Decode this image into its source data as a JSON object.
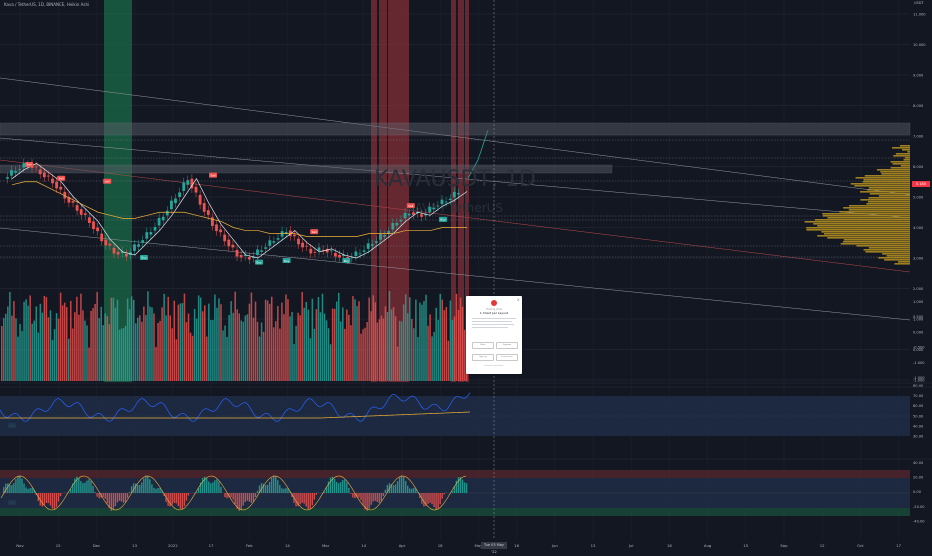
{
  "header": {
    "title": "Kava / TetherUS, 1D, BINANCE, Heikin Ashi"
  },
  "watermark": {
    "symbol": "KAVAUSDT, 1D",
    "name": "KAVA / TetherUS"
  },
  "axis_currency": "USDT",
  "current_price_badge": "5.180",
  "crosshair_date": "Tue 03 May '22",
  "popup": {
    "close": "×",
    "subtitle": "Trading View",
    "title": "1 Chart per Layout",
    "btn1": "Basic",
    "btn2": "Upgrade",
    "btn3": "Sign up",
    "btn4": "Learn more",
    "footer": "Continue with basic"
  },
  "colors": {
    "background": "#131722",
    "bull": "#26a69a",
    "bear": "#ef5350",
    "ma": "#f0b23a",
    "green_zone": "#1b6b48",
    "red_zone": "#7a2d34",
    "rsi": "#2962ff",
    "rsi_band": "#1e2b44"
  },
  "chart_data": {
    "type": "candlestick",
    "x_ticks": [
      "Nov",
      "15",
      "Dec",
      "13",
      "2022",
      "17",
      "Feb",
      "14",
      "Mar",
      "14",
      "Apr",
      "18",
      "May",
      "16",
      "Jun",
      "13",
      "Jul",
      "18",
      "Aug",
      "15",
      "Sep",
      "12",
      "Oct",
      "17"
    ],
    "price_ticks": [
      "11.000",
      "10.000",
      "9.000",
      "8.000",
      "7.000",
      "6.000",
      "5.000",
      "4.000",
      "3.000",
      "2.000",
      "1.000",
      "0.000",
      "-1.000"
    ],
    "volume_ticks": [
      "1.000",
      "0.500",
      "0.000",
      "-0.500",
      "-1.000",
      "-1.500"
    ],
    "rsi_ticks": [
      "80.00",
      "70.00",
      "60.00",
      "50.00",
      "40.00",
      "30.00"
    ],
    "osc_ticks": [
      "40.00",
      "20.00",
      "0.00",
      "-20.00",
      "-40.00"
    ],
    "price_path": [
      5.6,
      5.9,
      6.1,
      5.8,
      5.5,
      5.0,
      4.6,
      4.2,
      3.6,
      3.2,
      3.1,
      3.5,
      3.9,
      4.4,
      5.0,
      5.6,
      4.8,
      4.1,
      3.6,
      3.1,
      3.0,
      3.3,
      3.6,
      3.9,
      3.5,
      3.2,
      3.3,
      3.1,
      3.0,
      3.2,
      3.5,
      3.8,
      4.2,
      4.5,
      4.4,
      4.7,
      4.9,
      5.18
    ],
    "ma_path": [
      5.4,
      5.5,
      5.5,
      5.3,
      5.1,
      4.9,
      4.7,
      4.5,
      4.4,
      4.3,
      4.3,
      4.4,
      4.5,
      4.5,
      4.5,
      4.4,
      4.3,
      4.2,
      4.0,
      3.9,
      3.9,
      3.8,
      3.8,
      3.8,
      3.7,
      3.7,
      3.7,
      3.7,
      3.7,
      3.8,
      3.8,
      3.8,
      3.9,
      3.9,
      3.9,
      4.0,
      4.0,
      4.0
    ],
    "signals": [
      {
        "label": "Sell",
        "x": 0.05,
        "price": 6.05
      },
      {
        "label": "Sell",
        "x": 0.12,
        "price": 5.6
      },
      {
        "label": "Sell",
        "x": 0.22,
        "price": 5.5
      },
      {
        "label": "Buy",
        "x": 0.3,
        "price": 3.0
      },
      {
        "label": "Sell",
        "x": 0.45,
        "price": 5.7
      },
      {
        "label": "Buy",
        "x": 0.55,
        "price": 2.85
      },
      {
        "label": "Buy",
        "x": 0.61,
        "price": 2.9
      },
      {
        "label": "Sell",
        "x": 0.67,
        "price": 3.85
      },
      {
        "label": "Buy",
        "x": 0.74,
        "price": 2.9
      },
      {
        "label": "Sell",
        "x": 0.88,
        "price": 4.7
      },
      {
        "label": "Buy",
        "x": 0.95,
        "price": 4.25
      }
    ],
    "osc_labels": [
      {
        "label": "Buy",
        "panel": "rsi"
      },
      {
        "label": "Buy",
        "panel": "osc"
      }
    ]
  }
}
